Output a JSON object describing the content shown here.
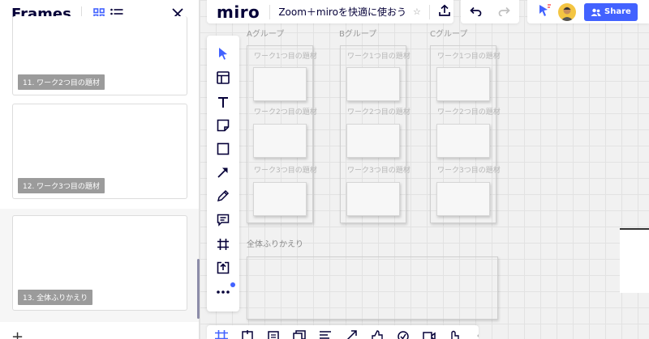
{
  "panel": {
    "title": "Frames",
    "frames": [
      {
        "label": "11. ワーク2つ目の題材"
      },
      {
        "label": "12. ワーク3つ目の題材"
      },
      {
        "label": "13. 全体ふりかえり"
      }
    ],
    "add_label": "+"
  },
  "topbar": {
    "logo": "miro",
    "board_name": "Zoom＋miroを快適に使おう",
    "share_label": "Share"
  },
  "board": {
    "groups": [
      "Aグループ",
      "Bグループ",
      "Cグループ"
    ],
    "topics": [
      "ワーク1つ目の題材",
      "ワーク2つ目の題材",
      "ワーク3つ目の題材"
    ],
    "reflection_label": "全体ふりかえり"
  },
  "colors": {
    "accent": "#4262ff",
    "frame_label_bg": "#9b9b9b"
  },
  "icons": {
    "toolbar": [
      "cursor-icon",
      "template-icon",
      "text-icon",
      "sticky-note-icon",
      "shape-icon",
      "arrow-icon",
      "pen-icon",
      "comment-icon",
      "frame-icon",
      "upload-icon",
      "more-icon"
    ]
  }
}
